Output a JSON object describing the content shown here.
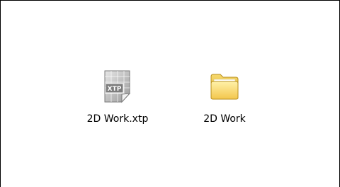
{
  "files": [
    {
      "name": "2D Work.xtp",
      "icon": "xtp-document-icon",
      "badge_text": "XTP"
    },
    {
      "name": "2D Work",
      "icon": "folder-icon"
    }
  ]
}
